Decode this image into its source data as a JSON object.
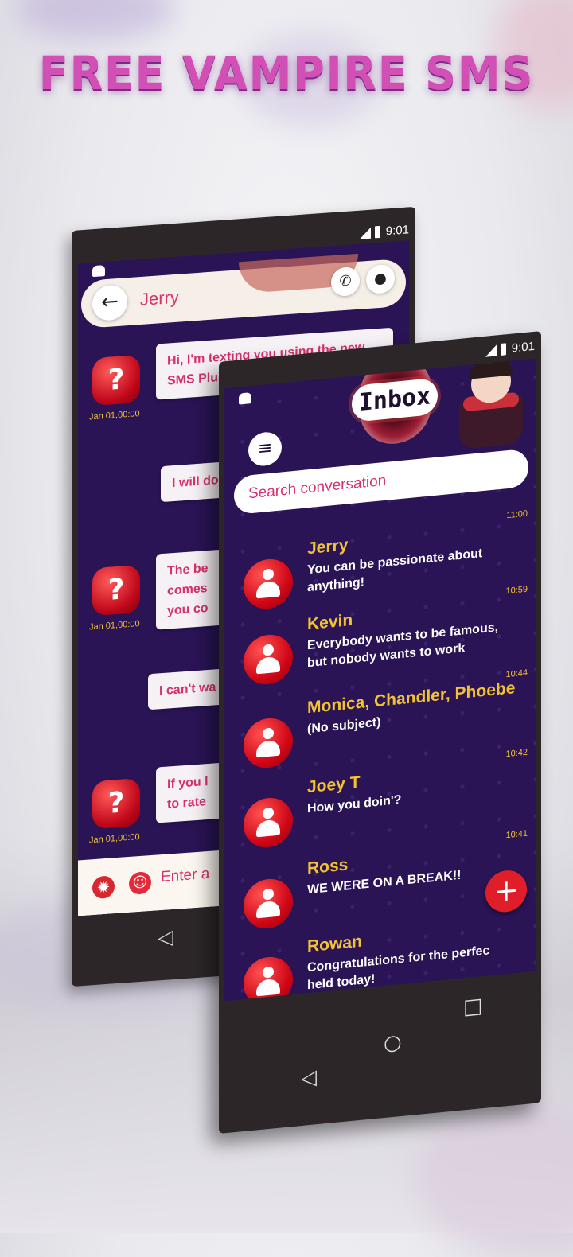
{
  "headline": "FREE VAMPIRE SMS",
  "status": {
    "time": "9:01"
  },
  "conversation": {
    "contact_name": "Jerry",
    "messages": [
      {
        "text": "Hi, I'm texting you using the new SMS Plus app and it's fantastic!",
        "date": "Jan 01,00:00",
        "incoming": true
      },
      {
        "text": "I will do",
        "incoming": false
      },
      {
        "text": "The be\ncomes\nyou co",
        "date": "Jan 01,00:00",
        "incoming": true
      },
      {
        "text": "I can't wa",
        "incoming": false
      },
      {
        "text": "If you l\nto rate",
        "date": "Jan 01,00:00",
        "incoming": true
      }
    ],
    "compose_placeholder": "Enter a"
  },
  "inbox": {
    "title": "Inbox",
    "search_placeholder": "Search conversation",
    "items": [
      {
        "name": "Jerry",
        "snippet": "You can be passionate about anything!",
        "time": "11:00"
      },
      {
        "name": "Kevin",
        "snippet": " Everybody wants to be famous, but nobody wants to work",
        "time": "10:59"
      },
      {
        "name": "Monica, Chandler, Phoebe",
        "snippet": "(No subject)",
        "time": "10:44"
      },
      {
        "name": "Joey T",
        "snippet": "How you doin'?",
        "time": "10:42"
      },
      {
        "name": "Ross",
        "snippet": "WE WERE ON A BREAK!!",
        "time": "10:41"
      },
      {
        "name": "Rowan",
        "snippet": "Congratulations for the perfec held today!",
        "time": "10:41"
      }
    ],
    "fab_label": "+"
  },
  "icons": {
    "back": "←",
    "call": "✆",
    "contact": "👤",
    "menu": "≡",
    "nav_back": "◁",
    "nav_home": "○",
    "nav_recent": "□"
  }
}
